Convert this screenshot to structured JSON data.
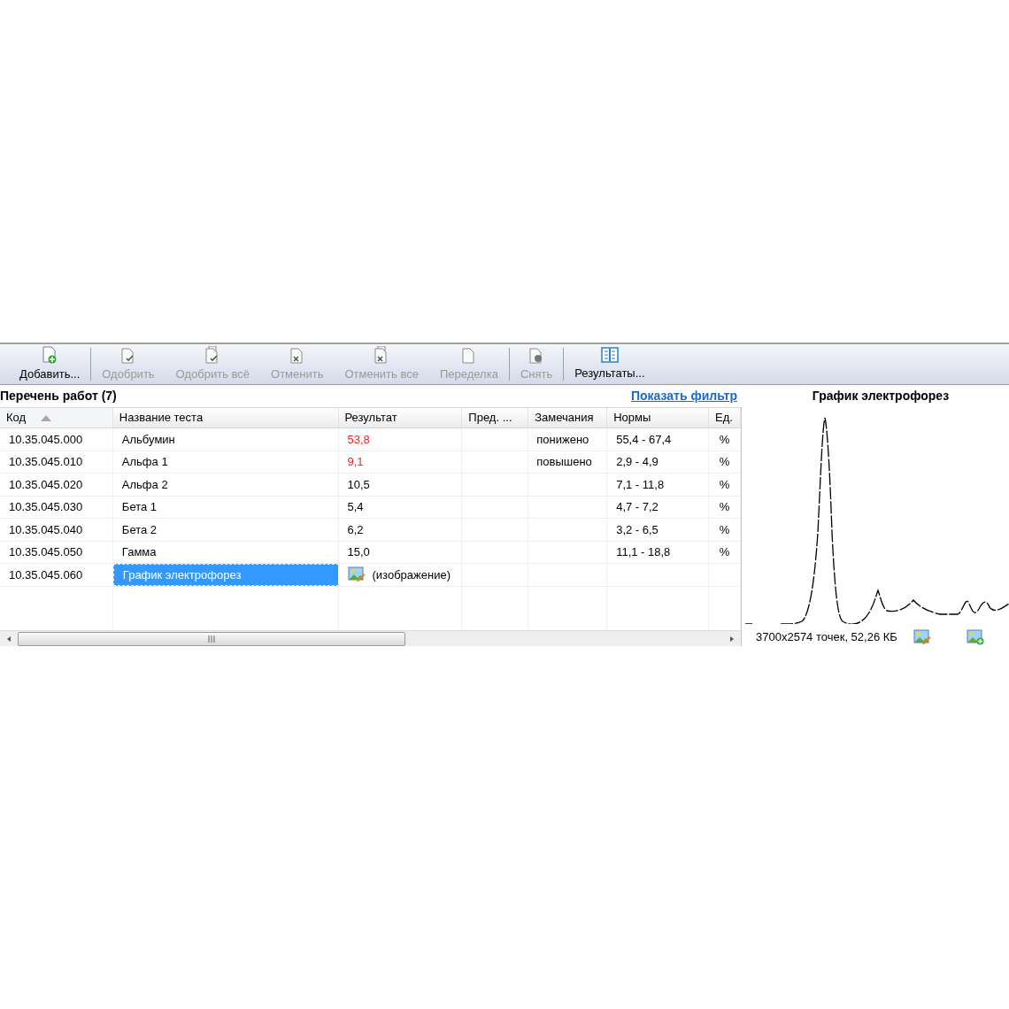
{
  "toolbar": [
    {
      "label": "Добавить...",
      "disabled": false,
      "separator_after": true,
      "kind": "add"
    },
    {
      "label": "Одобрить",
      "disabled": true,
      "separator_after": false,
      "kind": "approve"
    },
    {
      "label": "Одобрить всё",
      "disabled": true,
      "separator_after": false,
      "kind": "approve_all"
    },
    {
      "label": "Отменить",
      "disabled": true,
      "separator_after": false,
      "kind": "cancel"
    },
    {
      "label": "Отменить все",
      "disabled": true,
      "separator_after": false,
      "kind": "cancel_all"
    },
    {
      "label": "Переделка",
      "disabled": true,
      "separator_after": true,
      "kind": "redo"
    },
    {
      "label": "Снять",
      "disabled": true,
      "separator_after": true,
      "kind": "remove"
    },
    {
      "label": "Результаты...",
      "disabled": false,
      "separator_after": false,
      "kind": "results"
    }
  ],
  "list": {
    "title": "Перечень работ (7)",
    "filter_link": "Показать фильтр",
    "columns": [
      {
        "label": "Код",
        "sorted": true
      },
      {
        "label": "Название теста",
        "sorted": false
      },
      {
        "label": "Результат",
        "sorted": false
      },
      {
        "label": "Пред. ...",
        "sorted": false
      },
      {
        "label": "Замечания",
        "sorted": false
      },
      {
        "label": "Нормы",
        "sorted": false
      },
      {
        "label": "Ед.",
        "sorted": false
      }
    ],
    "rows": [
      {
        "code": "10.35.045.000",
        "name": "Альбумин",
        "result": "53,8",
        "abnormal": true,
        "kind": "text",
        "prev": "",
        "remark": "понижено",
        "norm": "55,4 - 67,4",
        "unit": "%",
        "selected": false
      },
      {
        "code": "10.35.045.010",
        "name": "Альфа 1",
        "result": "9,1",
        "abnormal": true,
        "kind": "text",
        "prev": "",
        "remark": "повышено",
        "norm": "2,9 - 4,9",
        "unit": "%",
        "selected": false
      },
      {
        "code": "10.35.045.020",
        "name": "Альфа 2",
        "result": "10,5",
        "abnormal": false,
        "kind": "text",
        "prev": "",
        "remark": "",
        "norm": "7,1 - 11,8",
        "unit": "%",
        "selected": false
      },
      {
        "code": "10.35.045.030",
        "name": "Бета 1",
        "result": "5,4",
        "abnormal": false,
        "kind": "text",
        "prev": "",
        "remark": "",
        "norm": "4,7 - 7,2",
        "unit": "%",
        "selected": false
      },
      {
        "code": "10.35.045.040",
        "name": "Бета 2",
        "result": "6,2",
        "abnormal": false,
        "kind": "text",
        "prev": "",
        "remark": "",
        "norm": "3,2 - 6,5",
        "unit": "%",
        "selected": false
      },
      {
        "code": "10.35.045.050",
        "name": "Гамма",
        "result": "15,0",
        "abnormal": false,
        "kind": "text",
        "prev": "",
        "remark": "",
        "norm": "11,1 - 18,8",
        "unit": "%",
        "selected": false
      },
      {
        "code": "10.35.045.060",
        "name": "График электрофорез",
        "result": "(изображение)",
        "abnormal": false,
        "kind": "image",
        "prev": "",
        "remark": "",
        "norm": "",
        "unit": "",
        "selected": true
      }
    ]
  },
  "preview": {
    "title": "График электрофорез",
    "info": "3700x2574 точек, 52,26 КБ"
  }
}
